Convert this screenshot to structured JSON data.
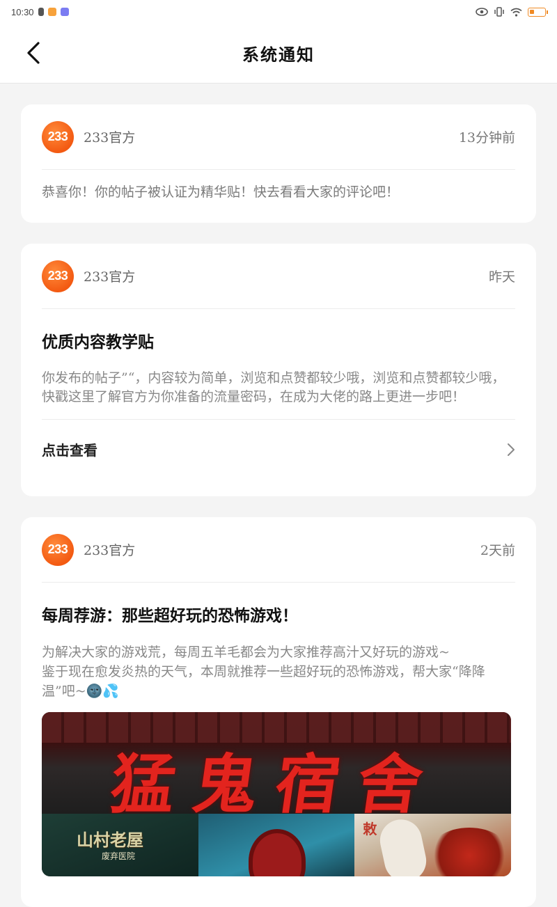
{
  "status_bar": {
    "time": "10:30"
  },
  "header": {
    "title": "系统通知"
  },
  "notifications": [
    {
      "avatar_text": "233",
      "sender": "233官方",
      "time": "13分钟前",
      "message": "恭喜你！你的帖子被认证为精华贴！快去看看大家的评论吧！"
    },
    {
      "avatar_text": "233",
      "sender": "233官方",
      "time": "昨天",
      "title": "优质内容教学贴",
      "body": "你发布的帖子”“，内容较为简单，浏览和点赞都较少哦，浏览和点赞都较少哦，快戳这里了解官方为你准备的流量密码，在成为大佬的路上更进一步吧！",
      "action": "点击查看"
    },
    {
      "avatar_text": "233",
      "sender": "233官方",
      "time": "2天前",
      "title": "每周荐游：那些超好玩的恐怖游戏！",
      "body_line1": "为解决大家的游戏荒，每周五羊毛都会为大家推荐高汁又好玩的游戏~",
      "body_line2": "鉴于现在愈发炎热的天气，本周就推荐一些超好玩的恐怖游戏，帮大家“降降温”吧~🌚💦",
      "banner": {
        "title": "猛鬼宿舍",
        "tile1_title": "山村老屋",
        "tile1_sub": "废弃医院",
        "tile3_mark": "敕"
      }
    }
  ]
}
